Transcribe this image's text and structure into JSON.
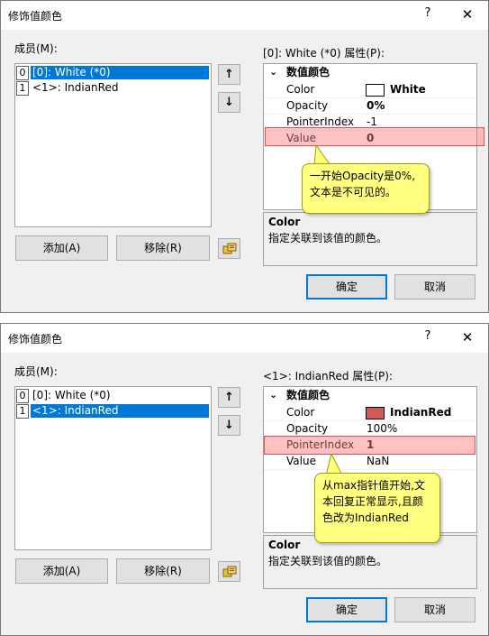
{
  "colors": {
    "dialog_bg": "#f0f0f0",
    "selection": "#0078d7",
    "highlight": "#ff7878",
    "callout_bg": "#ffff80",
    "white_swatch": "#ffffff",
    "indianred_swatch": "#cd5c5c"
  },
  "icons": {
    "help": "question-mark-icon",
    "close": "close-icon",
    "up": "arrow-up-icon",
    "down": "arrow-down-icon",
    "props": "property-pages-icon",
    "expand": "chevron-down-icon"
  },
  "dialogs": [
    {
      "title": "修饰值颜色",
      "help_glyph": "?",
      "close_glyph": "✕",
      "members_label": "成员(M):",
      "members": [
        {
          "index": "0",
          "text": "[0]: White (*0)",
          "selected": true
        },
        {
          "index": "1",
          "text": "<1>: IndianRed",
          "selected": false
        }
      ],
      "up_glyph": "↑",
      "down_glyph": "↓",
      "add_button": "添加(A)",
      "remove_button": "移除(R)",
      "props_label": "[0]: White (*0) 属性(P):",
      "category": "数值颜色",
      "expand_glyph": "⌄",
      "properties": [
        {
          "name": "Color",
          "value": "White"
        },
        {
          "name": "Opacity",
          "value": "0%"
        },
        {
          "name": "PointerIndex",
          "value": "-1"
        },
        {
          "name": "Value",
          "value": "0"
        }
      ],
      "desc_title": "Color",
      "desc_text": "指定关联到该值的颜色。",
      "ok_button": "确定",
      "cancel_button": "取消",
      "callout": [
        "一开始Opacity是0%,",
        "文本是不可见的。"
      ]
    },
    {
      "title": "修饰值颜色",
      "help_glyph": "?",
      "close_glyph": "✕",
      "members_label": "成员(M):",
      "members": [
        {
          "index": "0",
          "text": "[0]: White (*0)",
          "selected": false
        },
        {
          "index": "1",
          "text": "<1>: IndianRed",
          "selected": true
        }
      ],
      "up_glyph": "↑",
      "down_glyph": "↓",
      "add_button": "添加(A)",
      "remove_button": "移除(R)",
      "props_label": "<1>: IndianRed 属性(P):",
      "category": "数值颜色",
      "expand_glyph": "⌄",
      "properties": [
        {
          "name": "Color",
          "value": "IndianRed"
        },
        {
          "name": "Opacity",
          "value": "100%"
        },
        {
          "name": "PointerIndex",
          "value": "1"
        },
        {
          "name": "Value",
          "value": "NaN"
        }
      ],
      "desc_title": "Color",
      "desc_text": "指定关联到该值的颜色。",
      "ok_button": "确定",
      "cancel_button": "取消",
      "callout": [
        "从max指针值开始,文",
        "本回复正常显示,且颜",
        "色改为IndianRed"
      ]
    }
  ]
}
